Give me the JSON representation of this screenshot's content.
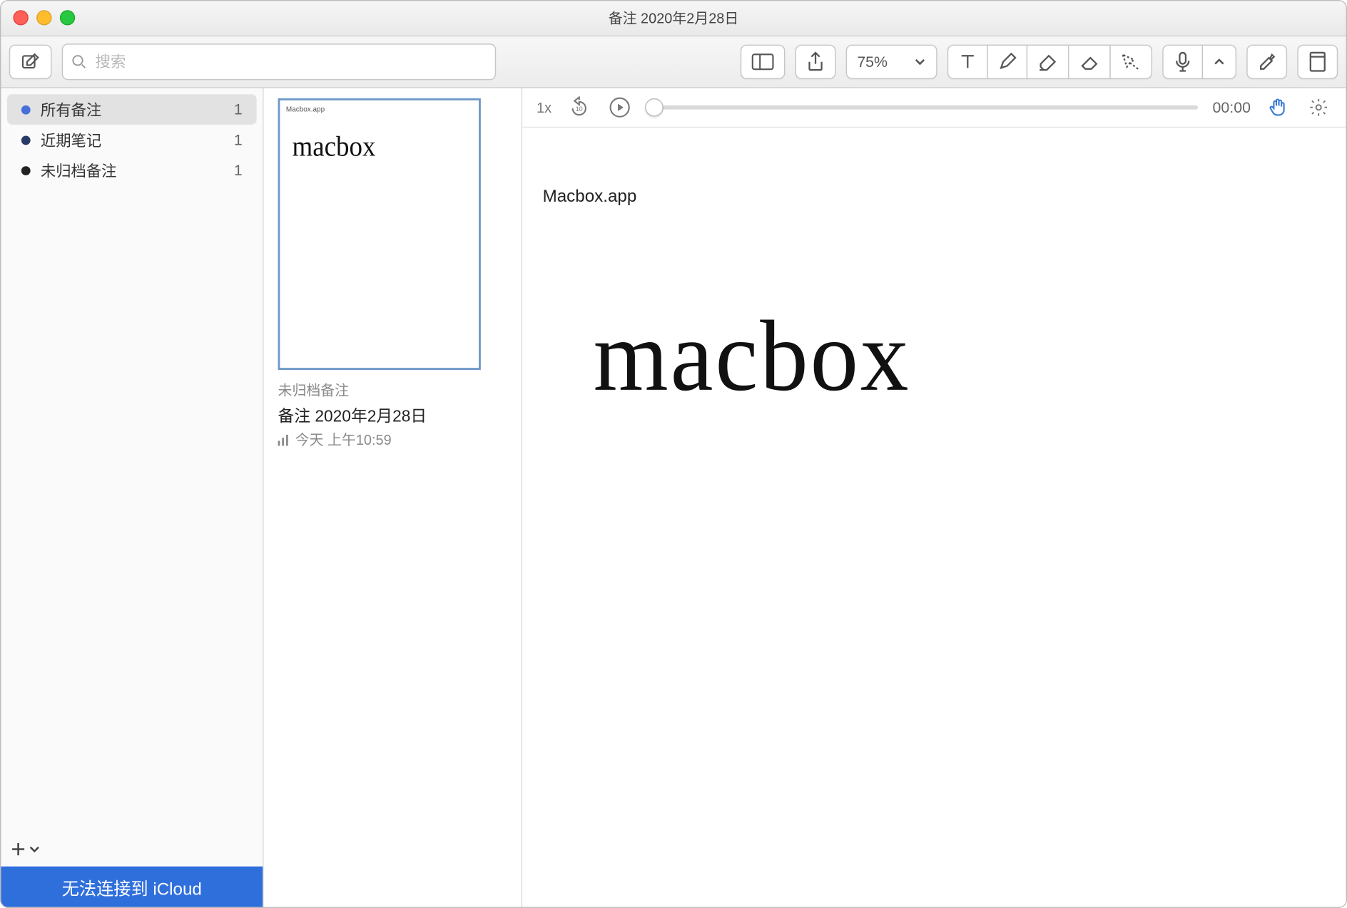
{
  "window": {
    "title": "备注 2020年2月28日"
  },
  "toolbar": {
    "search_placeholder": "搜索",
    "zoom": "75%"
  },
  "sidebar": {
    "items": [
      {
        "label": "所有备注",
        "count": "1",
        "dot": "#4670d8"
      },
      {
        "label": "近期笔记",
        "count": "1",
        "dot": "#2a3a66"
      },
      {
        "label": "未归档备注",
        "count": "1",
        "dot": "#222222"
      }
    ],
    "banner": "无法连接到 iCloud"
  },
  "notelist": {
    "thumb_top": "Macbox.app",
    "thumb_hand": "macbox",
    "subtitle": "未归档备注",
    "title": "备注 2020年2月28日",
    "time": "今天 上午10:59"
  },
  "playbar": {
    "speed": "1x",
    "time": "00:00"
  },
  "canvas": {
    "title": "Macbox.app",
    "hand": "macbox"
  }
}
